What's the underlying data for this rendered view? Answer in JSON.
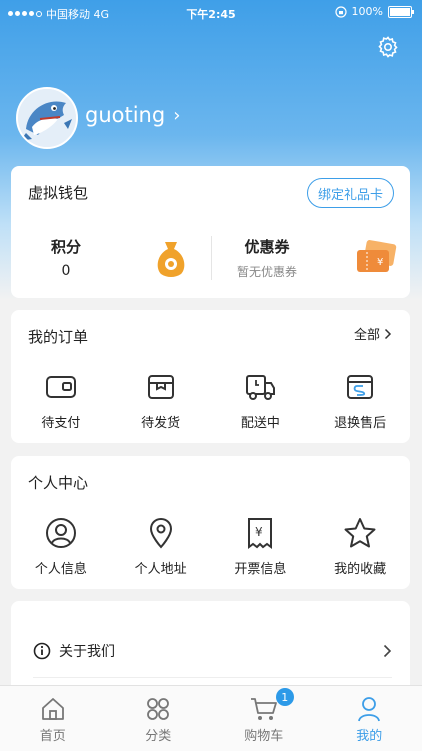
{
  "status_bar": {
    "carrier": "中国移动 4G",
    "time": "下午2:45",
    "battery": "100%"
  },
  "profile": {
    "username": "guoting",
    "chevron": "›"
  },
  "wallet": {
    "title": "虚拟钱包",
    "gift_card_button": "绑定礼品卡",
    "points_label": "积分",
    "points_value": "0",
    "coupon_label": "优惠券",
    "coupon_sub": "暂无优惠券"
  },
  "orders": {
    "title": "我的订单",
    "all_label": "全部",
    "items": [
      {
        "label": "待支付",
        "icon": "wallet-icon"
      },
      {
        "label": "待发货",
        "icon": "box-icon"
      },
      {
        "label": "配送中",
        "icon": "truck-icon"
      },
      {
        "label": "退换售后",
        "icon": "return-icon"
      }
    ]
  },
  "personal": {
    "title": "个人中心",
    "items": [
      {
        "label": "个人信息",
        "icon": "user-icon"
      },
      {
        "label": "个人地址",
        "icon": "location-icon"
      },
      {
        "label": "开票信息",
        "icon": "invoice-icon"
      },
      {
        "label": "我的收藏",
        "icon": "star-icon"
      }
    ]
  },
  "about": {
    "label": "关于我们"
  },
  "tabbar": {
    "items": [
      {
        "label": "首页",
        "icon": "home-icon"
      },
      {
        "label": "分类",
        "icon": "grid-icon"
      },
      {
        "label": "购物车",
        "icon": "cart-icon",
        "badge": "1"
      },
      {
        "label": "我的",
        "icon": "profile-icon",
        "active": true
      }
    ]
  },
  "colors": {
    "accent": "#3d9ee8",
    "header_top": "#3f9fe8",
    "coin": "#f0a22b"
  }
}
